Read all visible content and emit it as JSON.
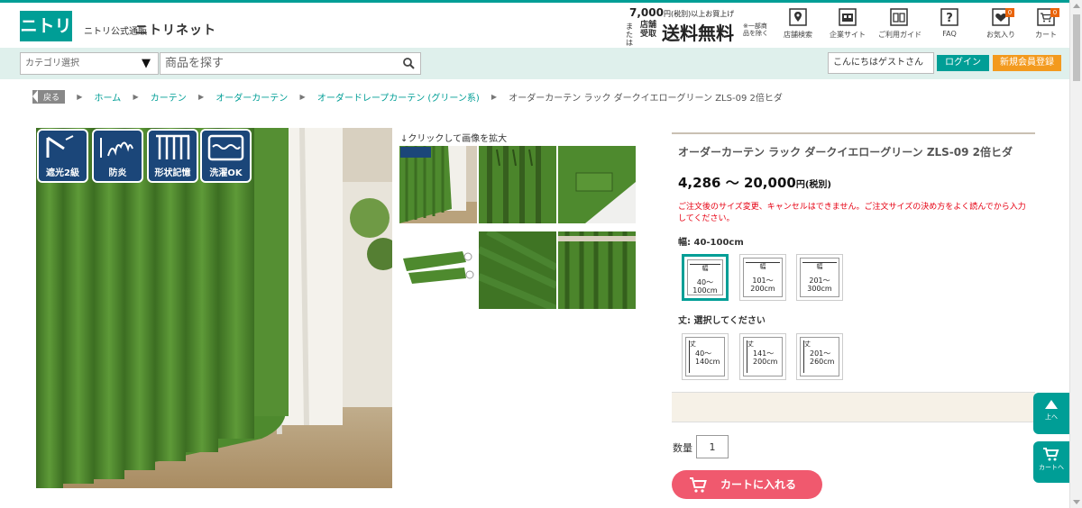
{
  "header": {
    "logo": "ニトリ",
    "site_sub": "ニトリ公式通販",
    "site_name": "ニトリネット",
    "promo": {
      "amount": "7,000",
      "condition": "円(税別)以上お買上げ",
      "or_text": "または",
      "store_pickup": "店舗受取",
      "free_shipping": "送料無料",
      "note": "※一部商品を除く"
    },
    "icons": [
      {
        "name": "store-search-icon",
        "label": "店舗検索"
      },
      {
        "name": "company-site-icon",
        "label": "企業サイト"
      },
      {
        "name": "guide-icon",
        "label": "ご利用ガイド"
      },
      {
        "name": "faq-icon",
        "label": "FAQ"
      },
      {
        "name": "favorite-icon",
        "label": "お気入り",
        "badge": "0"
      },
      {
        "name": "cart-icon",
        "label": "カート",
        "badge": "0"
      }
    ]
  },
  "search": {
    "category_label": "カテゴリ選択",
    "placeholder": "商品を探す",
    "greeting": "こんにちはゲストさん",
    "login_label": "ログイン",
    "register_label": "新規会員登録"
  },
  "breadcrumb": {
    "back_label": "戻る",
    "items": [
      "ホーム",
      "カーテン",
      "オーダーカーテン",
      "オーダードレープカーテン (グリーン系)"
    ],
    "current": "オーダーカーテン ラック ダークイエローグリーン ZLS-09 2倍ヒダ"
  },
  "gallery": {
    "features": [
      "遮光2級",
      "防炎",
      "形状記憶",
      "洗濯OK"
    ],
    "thumbs_hint": "↓クリックして画像を拡大"
  },
  "product": {
    "title": "オーダーカーテン ラック ダークイエローグリーン ZLS-09 2倍ヒダ",
    "price_min": "4,286",
    "price_sep": "～",
    "price_max": "20,000",
    "price_tax": "円(税別)",
    "notice": "ご注文後のサイズ変更、キャンセルはできません。ご注文サイズの決め方をよく読んでから入力してください。",
    "width_label": "幅: 40-100cm",
    "width_head": "幅",
    "width_options": [
      {
        "line1": "40～",
        "line2": "100cm"
      },
      {
        "line1": "101～",
        "line2": "200cm"
      },
      {
        "line1": "201～",
        "line2": "300cm"
      }
    ],
    "length_label": "丈: 選択してください",
    "length_head": "丈",
    "length_options": [
      {
        "line1": "40～",
        "line2": "140cm"
      },
      {
        "line1": "141～",
        "line2": "200cm"
      },
      {
        "line1": "201～",
        "line2": "260cm"
      }
    ],
    "qty_label": "数量",
    "qty_value": "1",
    "cart_label": "カートに入れる"
  },
  "floating": {
    "top_label": "上へ",
    "cart_label": "カートへ"
  },
  "colors": {
    "brand": "#009e96",
    "accent_orange": "#f39a1e",
    "cart_pink": "#f0596e",
    "curtain_green": "#4e8a2e",
    "notice_red": "#e60012"
  }
}
